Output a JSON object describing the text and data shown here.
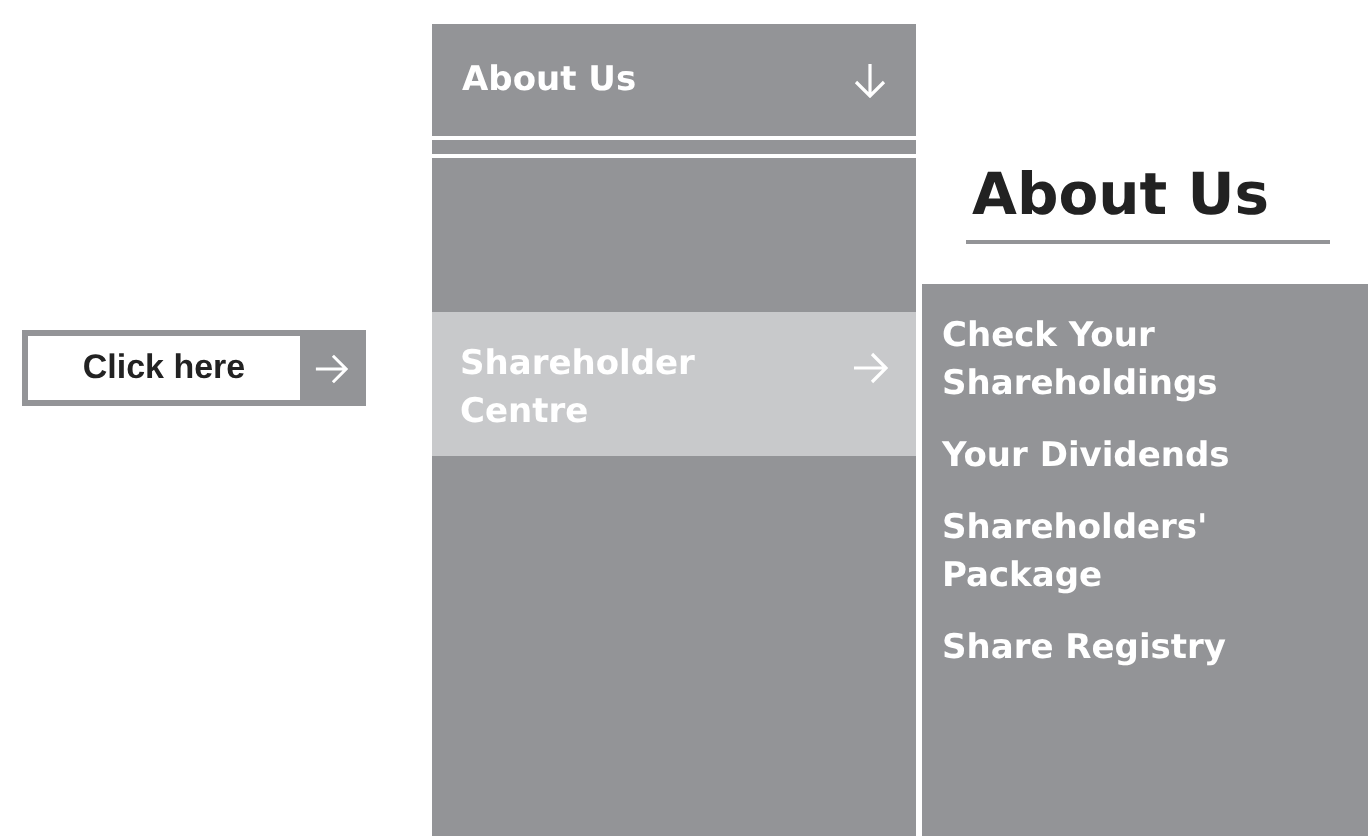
{
  "trigger_button": {
    "label": "Click here"
  },
  "menu": {
    "header": {
      "label": "About Us",
      "expanded": true
    },
    "items": [
      {
        "label": "Shareholder\nCentre",
        "selected": true
      }
    ]
  },
  "submenu": {
    "heading": "About Us",
    "items": [
      {
        "label": "Check Your\nShareholdings"
      },
      {
        "label": "Your Dividends"
      },
      {
        "label": "Shareholders'\nPackage"
      },
      {
        "label": "Share Registry"
      }
    ]
  }
}
